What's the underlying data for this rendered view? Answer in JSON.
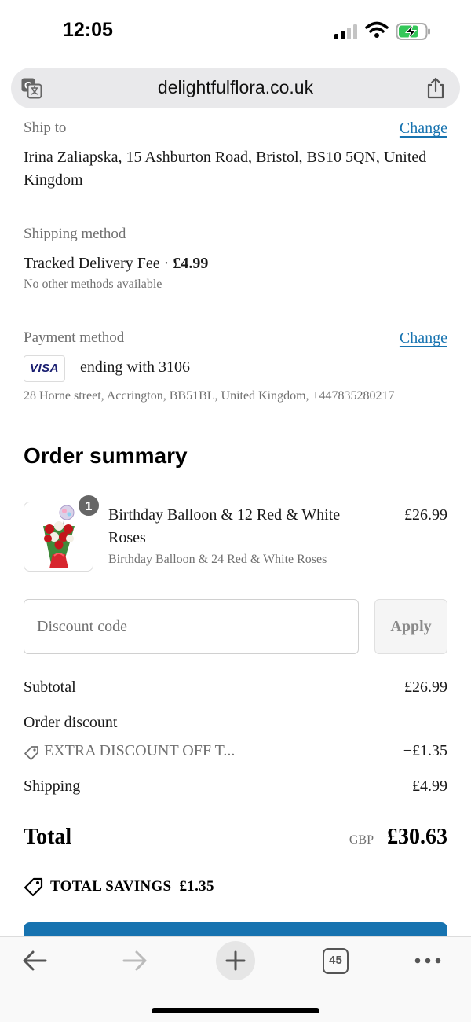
{
  "status_bar": {
    "time": "12:05"
  },
  "browser": {
    "url": "delightfulflora.co.uk"
  },
  "ship_to": {
    "label": "Ship to",
    "change_label": "Change",
    "address_line1": "Irina Zaliapska, 15 Ashburton Road, Bristol, BS10 5QN, United",
    "address_line2": "Kingdom"
  },
  "shipping_method": {
    "label": "Shipping method",
    "method_name": "Tracked Delivery Fee · ",
    "method_price": "£4.99",
    "note": "No other methods available"
  },
  "payment_method": {
    "label": "Payment method",
    "change_label": "Change",
    "card_brand": "VISA",
    "card_text": "ending with 3106",
    "billing_address": "28 Horne street, Accrington, BB51BL, United Kingdom, +447835280217"
  },
  "order_summary": {
    "title": "Order summary",
    "item": {
      "quantity": "1",
      "name_line1": "Birthday Balloon & 12 Red & White",
      "name_line2": "Roses",
      "variant": "Birthday Balloon & 24 Red & White Roses",
      "price": "£26.99"
    },
    "discount": {
      "placeholder": "Discount code",
      "apply_label": "Apply"
    },
    "subtotal_label": "Subtotal",
    "subtotal_value": "£26.99",
    "order_discount_label": "Order discount",
    "discount_code_name": "EXTRA DISCOUNT OFF T...",
    "discount_value": "−£1.35",
    "shipping_label": "Shipping",
    "shipping_value": "£4.99",
    "total_label": "Total",
    "total_currency": "GBP",
    "total_value": "£30.63",
    "savings_label": "TOTAL SAVINGS",
    "savings_value": "£1.35"
  },
  "toolbar": {
    "tab_count": "45"
  },
  "colors": {
    "link": "#1773b0",
    "primary_button": "#1773b0",
    "text": "#1a1a1a",
    "muted": "#707070"
  }
}
